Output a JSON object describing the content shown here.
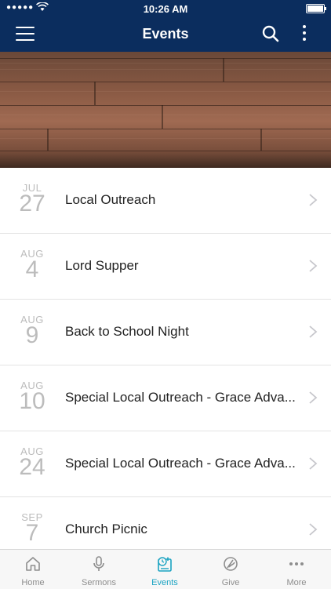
{
  "status_bar": {
    "time": "10:26 AM",
    "signal": "●●●●●"
  },
  "header": {
    "title": "Events"
  },
  "events": [
    {
      "month": "JUL",
      "day": "27",
      "name": "Local Outreach"
    },
    {
      "month": "AUG",
      "day": "4",
      "name": "Lord Supper"
    },
    {
      "month": "AUG",
      "day": "9",
      "name": "Back to School Night"
    },
    {
      "month": "AUG",
      "day": "10",
      "name": "Special Local Outreach - Grace Adva..."
    },
    {
      "month": "AUG",
      "day": "24",
      "name": "Special Local Outreach - Grace Adva..."
    },
    {
      "month": "SEP",
      "day": "7",
      "name": "Church Picnic"
    }
  ],
  "tabs": [
    {
      "label": "Home",
      "icon": "home-icon"
    },
    {
      "label": "Sermons",
      "icon": "microphone-icon"
    },
    {
      "label": "Events",
      "icon": "calendar-icon",
      "active": true
    },
    {
      "label": "Give",
      "icon": "give-icon"
    },
    {
      "label": "More",
      "icon": "more-icon"
    }
  ],
  "colors": {
    "nav": "#0b2d5e",
    "accent": "#1aa3c2",
    "inactive": "#8e8e8e"
  }
}
